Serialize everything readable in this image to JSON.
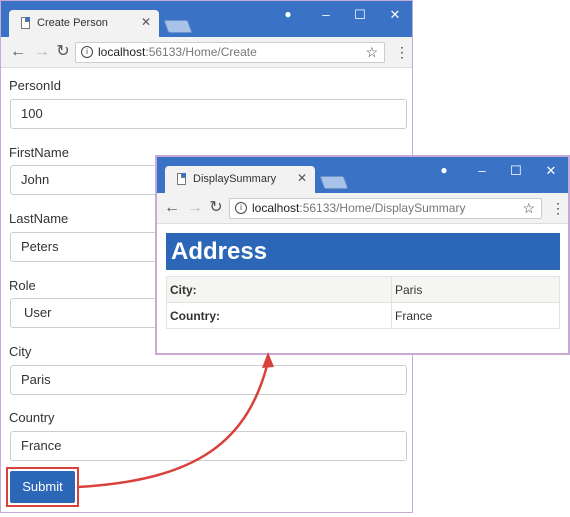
{
  "windows": {
    "create": {
      "tab_title": "Create Person",
      "url_host": "localhost",
      "url_path": ":56133/Home/Create",
      "fields": [
        {
          "label": "PersonId",
          "value": "100"
        },
        {
          "label": "FirstName",
          "value": "John"
        },
        {
          "label": "LastName",
          "value": "Peters"
        },
        {
          "label": "Role",
          "value": "User"
        },
        {
          "label": "City",
          "value": "Paris"
        },
        {
          "label": "Country",
          "value": "France"
        }
      ],
      "submit_label": "Submit"
    },
    "summary": {
      "tab_title": "DisplaySummary",
      "url_host": "localhost",
      "url_path": ":56133/Home/DisplaySummary",
      "heading": "Address",
      "rows": [
        {
          "key": "City:",
          "value": "Paris"
        },
        {
          "key": "Country:",
          "value": "France"
        }
      ]
    }
  },
  "icons": {
    "tab": "document-icon",
    "tab_close": "close-icon",
    "back": "back-arrow-icon",
    "forward": "forward-arrow-icon",
    "reload": "reload-icon",
    "info": "info-icon",
    "bookmark": "star-icon",
    "menu": "kebab-menu-icon",
    "account": "user-icon",
    "minimize": "minimize-icon",
    "maximize": "maximize-icon",
    "window_close": "close-icon"
  },
  "colors": {
    "titlebar": "#3a73c6",
    "button": "#2b66b7",
    "highlight": "#d9413c"
  }
}
